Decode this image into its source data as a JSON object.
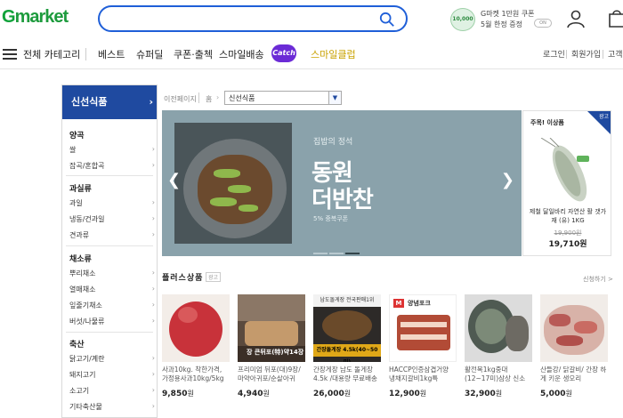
{
  "header": {
    "logo_g": "G",
    "logo_rest": "market",
    "search": {
      "value": "",
      "placeholder": ""
    },
    "coupon": {
      "badge": "10,000",
      "line1": "G마켓 1만원 쿠폰",
      "line2": "5월 한정 증정",
      "pill": "ON"
    }
  },
  "nav": {
    "all_categories": "전체 카테고리",
    "items": [
      "베스트",
      "슈퍼딜",
      "쿠폰·출첵",
      "스마일배송"
    ],
    "catch": "Catch",
    "smile_club": "스마일클럽",
    "right": [
      "로그인",
      "회원가입",
      "고객"
    ]
  },
  "sidebar": {
    "title": "신선식품",
    "groups": [
      {
        "name": "양곡",
        "items": [
          "쌀",
          "잡곡/혼합곡"
        ]
      },
      {
        "name": "과실류",
        "items": [
          "과일",
          "냉동/건과일",
          "견과류"
        ]
      },
      {
        "name": "채소류",
        "items": [
          "뿌리채소",
          "열매채소",
          "잎줄기채소",
          "버섯/나물류"
        ]
      },
      {
        "name": "축산",
        "items": [
          "닭고기/계란",
          "돼지고기",
          "소고기",
          "기타축산물"
        ]
      }
    ]
  },
  "breadcrumb": {
    "prev": "이전페이지",
    "home": "홈",
    "current": "신선식품"
  },
  "banner": {
    "subtitle": "집밥의 정석",
    "title1": "동원",
    "title2": "더반찬",
    "note": "5% 중복쿠폰"
  },
  "promo": {
    "title": "주목! 이상품",
    "corner": "광고",
    "name": "제철 달일바리 자연산 활 갯가재 (유) 1KG",
    "old_price": "19,900원",
    "price": "19,710원"
  },
  "plus": {
    "title": "플러스상품",
    "tag": "광고",
    "more": "신청하기 >",
    "products": [
      {
        "name": "사과10kg. 착한가격, 가정용사과10kg/5kg",
        "price": "9,850",
        "won": "원"
      },
      {
        "name": "프리미엄 뒤포(대)9장/마약아귀포/순살아귀",
        "price": "4,940",
        "won": "원"
      },
      {
        "name": "간장게장 남도 돌게장 4.5k /대용량 무료배송",
        "price": "26,000",
        "won": "원"
      },
      {
        "name": "HACCP인증삼겹거양 냉채지갈비1kg특",
        "price": "12,900",
        "won": "원"
      },
      {
        "name": "활전복1kg중대(12~17미)삼상 신소",
        "price": "32,900",
        "won": "원"
      },
      {
        "name": "산들강/ 닭갈비/ 간장 하게 키운 생오리",
        "price": "5,000",
        "won": "원"
      }
    ]
  },
  "colors": {
    "accent_blue": "#1f4aa0",
    "brand_green": "#1d9b3d",
    "catch_purple": "#6b2bd6"
  }
}
